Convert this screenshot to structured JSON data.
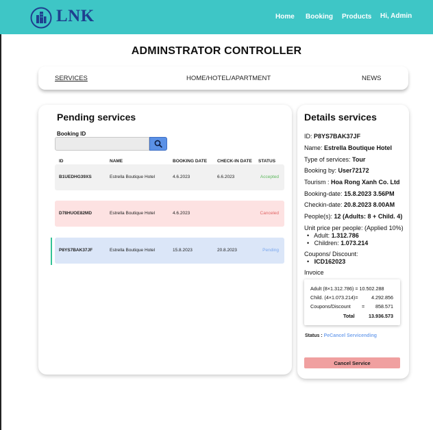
{
  "header": {
    "brand": "LNK",
    "nav": [
      "Home",
      "Booking",
      "Products"
    ],
    "greeting": "Hi, Admin"
  },
  "page_title": "ADMINSTRATOR CONTROLLER",
  "tabs": [
    "SERVICES",
    "HOME/HOTEL/APARTMENT",
    "NEWS"
  ],
  "pending": {
    "title": "Pending services",
    "search_label": "Booking ID",
    "search_value": "",
    "columns": [
      "ID",
      "NAME",
      "BOOKING DATE",
      "CHECK-IN DATE",
      "STATUS"
    ],
    "rows": [
      {
        "id": "B1UEDHG39XS",
        "name": "Estrella Boutique Hotel",
        "booking_date": "4.6.2023",
        "checkin_date": "6.6.2023",
        "status": "Accepted"
      },
      {
        "id": "D78HUOE82MD",
        "name": "Estrella Boutique Hotel",
        "booking_date": "4.6.2023",
        "checkin_date": "",
        "status": "Canceled"
      },
      {
        "id": "P8YS7BAK37JF",
        "name": "Estrella Boutique Hotel",
        "booking_date": "15.8.2023",
        "checkin_date": "20.8.2023",
        "status": "Pending"
      }
    ]
  },
  "details": {
    "title": "Details services",
    "id_label": "ID:",
    "id_value": "P8YS7BAK37JF",
    "name_label": "Name:",
    "name_value": "Estrella Boutique Hotel",
    "type_label": "Type of services:",
    "type_value": "Tour",
    "bookedby_label": "Booking by:",
    "bookedby_value": "User72172",
    "tourism_label": "Tourism :",
    "tourism_value": "Hoa Rong Xanh Co.  Ltd",
    "bookingdate_label": "Booking-date:",
    "bookingdate_value": "15.8.2023  3.56PM",
    "checkin_label": "Checkin-date:",
    "checkin_value": "20.8.2023  8.00AM",
    "people_label": "People(s):",
    "people_value": "12 (Adults: 8 + Child. 4)",
    "unitprice_label": "Unit price per people: (Applied 10%)",
    "adult_label": "Adult:",
    "adult_value": "1.312.786",
    "children_label": "Children:",
    "children_value": "1.073.214",
    "coupons_label": "Coupons/ Discount:",
    "coupon_code": "ICD162023",
    "invoice_label": "Invoice",
    "invoice": {
      "adult_line": "Adult  (8×1.312.786) = 10.502.288",
      "child_formula": "Child.  (4×1.073.214)=",
      "child_amount": "4.292.856",
      "coupon_label": "Coupons/Discount",
      "coupon_eq": "=",
      "coupon_amount": "858.571",
      "total_label": "Total",
      "total_amount": "13.936.573"
    },
    "status_label": "Status :",
    "status_value": "PeCancel Servicending",
    "cancel_button": "Cancel Service"
  },
  "colors": {
    "header_bg": "#3ec6c6",
    "brand": "#1f3f8f",
    "accepted": "#5cb85c",
    "canceled": "#e06666",
    "pending": "#7aa7ee",
    "cancel_button": "#f0a0a0"
  }
}
